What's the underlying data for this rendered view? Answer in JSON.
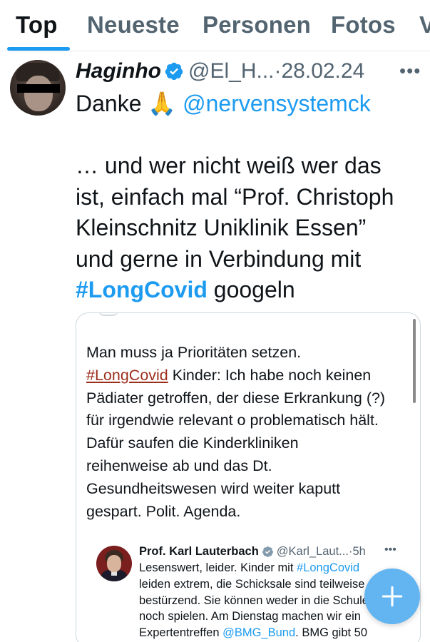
{
  "tabs": [
    {
      "label": "Top",
      "active": true
    },
    {
      "label": "Neueste",
      "active": false
    },
    {
      "label": "Personen",
      "active": false
    },
    {
      "label": "Fotos",
      "active": false
    },
    {
      "label": "V",
      "active": false
    }
  ],
  "tweet": {
    "display_name": "Haginho",
    "handle": "@El_H...",
    "separator": "·",
    "date": "28.02.24",
    "more_icon": "more-dots-icon",
    "verified_icon": "verified-badge-icon",
    "line1_text": "Danke",
    "line1_emoji": "🙏",
    "line1_mention": "@nervensystemck",
    "lines": [
      "… und wer nicht weiß wer das",
      "ist, einfach mal “Prof. Christoph",
      "Kleinschnitz Uniklinik Essen”",
      "und gerne in Verbindung mit"
    ],
    "last_line_hashtag": "#LongCovid",
    "last_line_text": " googeln"
  },
  "quote": {
    "line1": "Man muss ja Prioritäten setzen.",
    "line2_hashtag": "#LongCovid",
    "line2_text": " Kinder: Ich habe noch keinen",
    "lines": [
      "Pädiater getroffen, der diese Erkrankung (?)",
      "für irgendwie relevant o problematisch hält.",
      "Dafür saufen die Kinderkliniken",
      "reihenweise ab und das Dt.",
      "Gesundheitswesen wird weiter kaputt",
      "gespart. Polit. Agenda."
    ]
  },
  "inner_tweet": {
    "display_name": "Prof. Karl Lauterbach",
    "handle": "@Karl_Laut...",
    "separator": "·",
    "time": "5h",
    "more_icon": "more-dots-icon",
    "line1_text": "Lesenswert, leider. Kinder mit ",
    "line1_hashtag": "#LongCovid",
    "lines": [
      "leiden extrem, die Schicksale sind teilweise",
      "bestürzend. Sie können weder in die Schule",
      "noch spielen. Am Dienstag machen wir ein"
    ],
    "line5_text": "Expertentreffen ",
    "line5_mention": "@BMG_Bund",
    "line5_rest": ". BMG gibt 50"
  },
  "fab": {
    "icon": "plus-icon"
  },
  "colors": {
    "accent": "#1d9bf0",
    "fab": "#63b5f2",
    "muted": "#536471",
    "quote_hashtag": "#9c2f1c"
  }
}
